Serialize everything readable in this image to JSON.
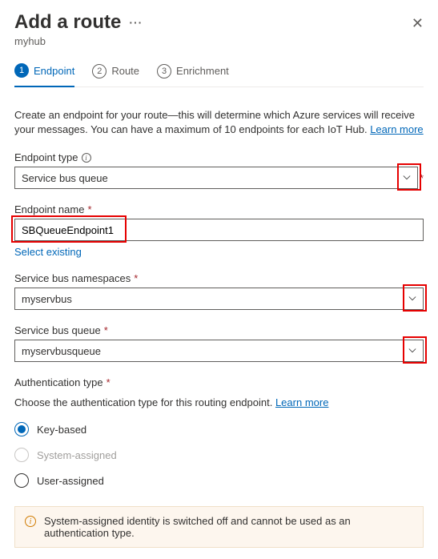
{
  "header": {
    "title": "Add a route",
    "subtitle": "myhub"
  },
  "stepper": {
    "items": [
      {
        "num": "1",
        "label": "Endpoint",
        "active": true
      },
      {
        "num": "2",
        "label": "Route",
        "active": false
      },
      {
        "num": "3",
        "label": "Enrichment",
        "active": false
      }
    ]
  },
  "intro": {
    "text": "Create an endpoint for your route—this will determine which Azure services will receive your messages. You can have a maximum of 10 endpoints for each IoT Hub. ",
    "link": "Learn more"
  },
  "fields": {
    "endpointType": {
      "label": "Endpoint type",
      "value": "Service bus queue"
    },
    "endpointName": {
      "label": "Endpoint name",
      "required": "*",
      "value": "SBQueueEndpoint1",
      "selectExisting": "Select existing"
    },
    "namespaces": {
      "label": "Service bus namespaces",
      "required": "*",
      "value": "myservbus"
    },
    "queue": {
      "label": "Service bus queue",
      "required": "*",
      "value": "myservbusqueue"
    },
    "authType": {
      "label": "Authentication type",
      "required": "*",
      "help": "Choose the authentication type for this routing endpoint. ",
      "helpLink": "Learn more",
      "options": {
        "key": {
          "label": "Key-based"
        },
        "system": {
          "label": "System-assigned"
        },
        "user": {
          "label": "User-assigned"
        }
      }
    }
  },
  "message": {
    "text": "System-assigned identity is switched off and cannot be used as an authentication type."
  },
  "reqMarker": "*"
}
